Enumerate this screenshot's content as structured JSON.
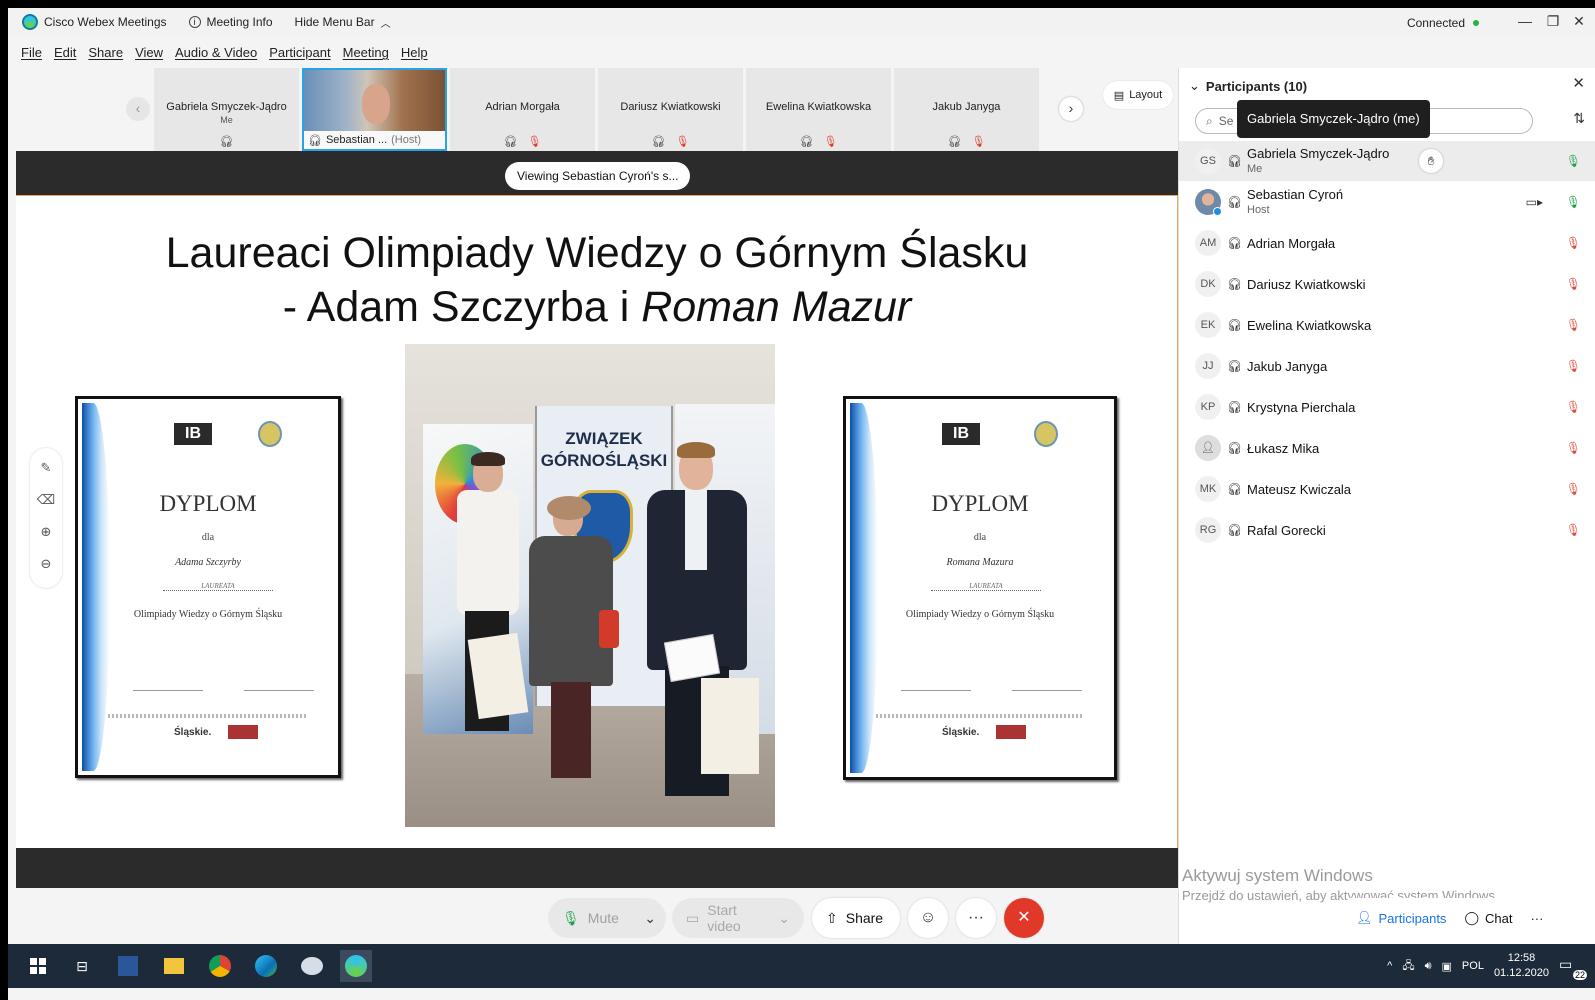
{
  "titlebar": {
    "app_name": "Cisco Webex Meetings",
    "meeting_info": "Meeting Info",
    "hide_menu": "Hide Menu Bar",
    "status": "Connected",
    "minimize": "—",
    "restore": "❐",
    "close": "✕"
  },
  "menu": [
    "File",
    "Edit",
    "Share",
    "View",
    "Audio & Video",
    "Participant",
    "Meeting",
    "Help"
  ],
  "strip": {
    "tiles": [
      {
        "name": "Gabriela Smyczek-Jądro",
        "sub": "Me"
      },
      {
        "name": "Sebastian ...",
        "sub": "(Host)"
      },
      {
        "name": "Adrian Morgała",
        "sub": ""
      },
      {
        "name": "Dariusz Kwiatkowski",
        "sub": ""
      },
      {
        "name": "Ewelina Kwiatkowska",
        "sub": ""
      },
      {
        "name": "Jakub Janyga",
        "sub": ""
      }
    ],
    "layout_label": "Layout"
  },
  "stage": {
    "viewing": "Viewing Sebastian Cyroń's s...",
    "title_line1": "Laureaci Olimpiady Wiedzy o Górnym Ślasku",
    "title_line2_a": "- Adam Szczyrba i ",
    "title_line2_b": "Roman Mazur",
    "diplomas": [
      {
        "title": "DYPLOM",
        "dla": "dla",
        "who": "Adama Szczyrby",
        "laur": "LAUREATA",
        "olymp": "Olimpiady Wiedzy o Górnym Śląsku",
        "brand": "Śląskie."
      },
      {
        "title": "DYPLOM",
        "dla": "dla",
        "who": "Romana Mazura",
        "laur": "LAUREATA",
        "olymp": "Olimpiady Wiedzy o Górnym Śląsku",
        "brand": "Śląskie."
      }
    ],
    "photo_banner": "ZWIĄZEK GÓRNOŚLĄSKI"
  },
  "controls": {
    "mute": "Mute",
    "start_video": "Start video",
    "share": "Share",
    "more": "···",
    "end": "✕"
  },
  "panel": {
    "title": "Participants (10)",
    "search_placeholder": "Se",
    "tooltip": "Gabriela Smyczek-Jądro (me)",
    "participants": [
      {
        "initials": "GS",
        "name": "Gabriela Smyczek-Jądro",
        "role": "Me",
        "mic": "on"
      },
      {
        "initials": "",
        "name": "Sebastian Cyroń",
        "role": "Host",
        "mic": "on"
      },
      {
        "initials": "AM",
        "name": "Adrian Morgała",
        "role": "",
        "mic": "off"
      },
      {
        "initials": "DK",
        "name": "Dariusz Kwiatkowski",
        "role": "",
        "mic": "off"
      },
      {
        "initials": "EK",
        "name": "Ewelina Kwiatkowska",
        "role": "",
        "mic": "off"
      },
      {
        "initials": "JJ",
        "name": "Jakub Janyga",
        "role": "",
        "mic": "off"
      },
      {
        "initials": "KP",
        "name": "Krystyna Pierchala",
        "role": "",
        "mic": "off"
      },
      {
        "initials": "",
        "name": "Łukasz Mika",
        "role": "",
        "mic": "off"
      },
      {
        "initials": "MK",
        "name": "Mateusz Kwiczala",
        "role": "",
        "mic": "off"
      },
      {
        "initials": "RG",
        "name": "Rafal Gorecki",
        "role": "",
        "mic": "off"
      }
    ],
    "participants_btn": "Participants",
    "chat_btn": "Chat",
    "more_btn": "···"
  },
  "watermark": {
    "line1": "Aktywuj system Windows",
    "line2": "Przejdź do ustawień, aby aktywować system Windows."
  },
  "taskbar": {
    "lang": "POL",
    "time": "12:58",
    "date": "01.12.2020",
    "notif": "22"
  },
  "colors": {
    "accent": "#1a73e8",
    "end_call": "#e2382a",
    "mic_on": "#19a348",
    "mic_off": "#e24b3a",
    "taskbar": "#1d2a3a"
  }
}
